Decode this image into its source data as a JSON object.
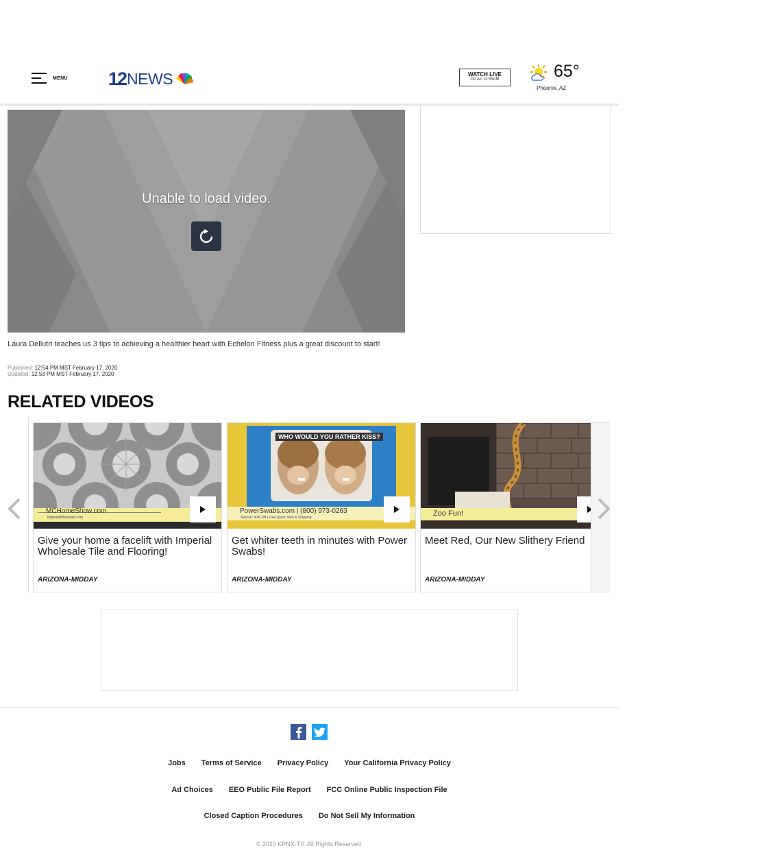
{
  "header": {
    "menu_label": "MENU",
    "logo_number": "12",
    "logo_text": "NEWS",
    "watch_live_title": "WATCH LIVE",
    "watch_live_sub": "On Air 11:55AM",
    "weather_temp": "65°",
    "weather_location": "Phoenix, AZ"
  },
  "video": {
    "error_message": "Unable to load video."
  },
  "article": {
    "caption": "Laura Dellutri teaches us 3 tips to achieving a healthier heart with Echelon Fitness plus a great discount to start!",
    "published_label": "Published:",
    "published_value": "12:54 PM MST February 17, 2020",
    "updated_label": "Updated:",
    "updated_value": "12:53 PM MST February 17, 2020"
  },
  "related": {
    "title": "RELATED VIDEOS",
    "cards": [
      {
        "headline": "Give your home a facelift with Imperial Wholesale Tile and Flooring!",
        "tag": "ARIZONA-MIDDAY",
        "overlay_main": "MCHomeShow.com",
        "overlay_sub": "ImperialWholesale.com"
      },
      {
        "headline": "Get whiter teeth in minutes with Power Swabs!",
        "tag": "ARIZONA-MIDDAY",
        "banner": "WHO WOULD YOU RATHER KISS?",
        "overlay_main": "PowerSwabs.com | (800) 973-0263",
        "overlay_sub": "Special: 40% Off | Free Quick Stick & Shipping"
      },
      {
        "headline": "Meet Red, Our New Slithery Friend",
        "tag": "ARIZONA-MIDDAY",
        "overlay_main": "Zoo Fun!"
      }
    ]
  },
  "footer": {
    "row1": [
      "Jobs",
      "Terms of Service",
      "Privacy Policy",
      "Your California Privacy Policy"
    ],
    "row2": [
      "Ad Choices",
      "EEO Public File Report",
      "FCC Online Public Inspection File"
    ],
    "row3": [
      "Closed Caption Procedures",
      "Do Not Sell My Information"
    ],
    "copyright": "© 2020 KPNX-TV. All Rights Reserved."
  },
  "colors": {
    "brand_blue": "#1f3f8a",
    "facebook": "#3b5998",
    "twitter": "#1da1f2",
    "retry_button": "#2b3445"
  },
  "icons": [
    "menu-icon",
    "peacock-logo-icon",
    "sun-cloud-icon",
    "retry-icon",
    "play-icon",
    "chevron-left-icon",
    "chevron-right-icon",
    "facebook-icon",
    "twitter-icon"
  ]
}
